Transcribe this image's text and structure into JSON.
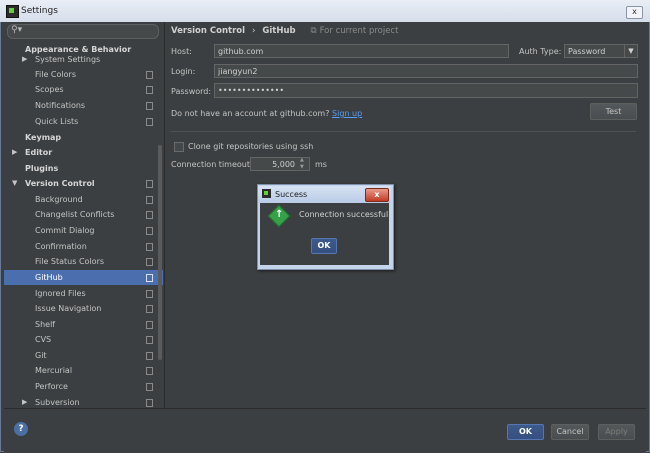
{
  "window": {
    "title": "Settings",
    "close_glyph": "x"
  },
  "search": {
    "icon": "search-icon",
    "value": ""
  },
  "sidebar": {
    "items": [
      {
        "label": "Appearance & Behavior",
        "bold": true,
        "arrow": ""
      },
      {
        "label": "System Settings",
        "arrow": "▶"
      },
      {
        "label": "File Colors"
      },
      {
        "label": "Scopes"
      },
      {
        "label": "Notifications"
      },
      {
        "label": "Quick Lists"
      },
      {
        "label": "Keymap",
        "bold": true
      },
      {
        "label": "Editor",
        "bold": true,
        "arrow": "▶"
      },
      {
        "label": "Plugins",
        "bold": true
      },
      {
        "label": "Version Control",
        "bold": true,
        "arrow": "▼"
      },
      {
        "label": "Background"
      },
      {
        "label": "Changelist Conflicts"
      },
      {
        "label": "Commit Dialog"
      },
      {
        "label": "Confirmation"
      },
      {
        "label": "File Status Colors"
      },
      {
        "label": "GitHub",
        "selected": true
      },
      {
        "label": "Ignored Files"
      },
      {
        "label": "Issue Navigation"
      },
      {
        "label": "Shelf"
      },
      {
        "label": "CVS"
      },
      {
        "label": "Git"
      },
      {
        "label": "Mercurial"
      },
      {
        "label": "Perforce"
      },
      {
        "label": "Subversion",
        "arrow": "▶"
      }
    ]
  },
  "breadcrumb": {
    "parent": "Version Control",
    "sep": "›",
    "current": "GitHub",
    "scope": "For current project"
  },
  "form": {
    "host_label": "Host:",
    "host_value": "github.com",
    "auth_label": "Auth Type:",
    "auth_value": "Password",
    "login_label": "Login:",
    "login_value": "jiangyun2",
    "password_label": "Password:",
    "password_value": "••••••••••••••",
    "account_text": "Do not have an account at github.com?",
    "signup_link": "Sign up",
    "test_button": "Test",
    "clone_ssh_label": "Clone git repositories using ssh",
    "clone_ssh_checked": false,
    "timeout_label": "Connection timeout:",
    "timeout_value": "5,000",
    "timeout_unit": "ms"
  },
  "dialog": {
    "title": "Success",
    "message": "Connection successful",
    "ok": "OK",
    "close_glyph": "x"
  },
  "footer": {
    "help": "?",
    "ok": "OK",
    "cancel": "Cancel",
    "apply": "Apply"
  },
  "colors": {
    "selection": "#4b6eaf",
    "link": "#589df6",
    "panel": "#3c3f41"
  }
}
